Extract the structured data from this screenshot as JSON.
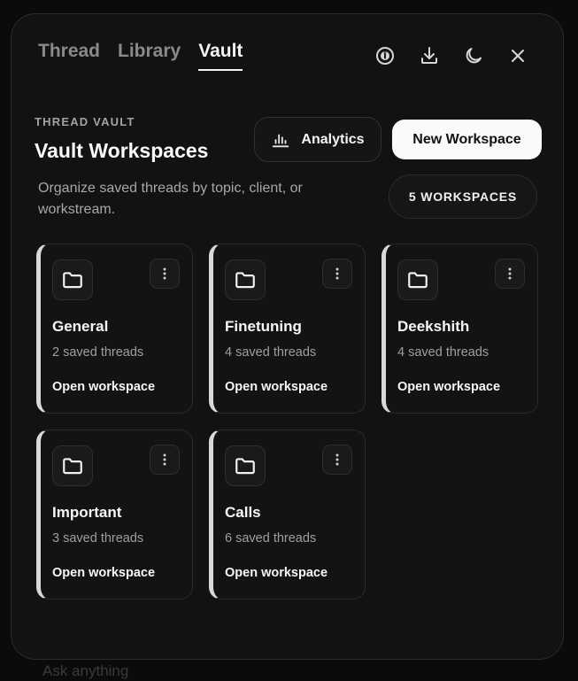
{
  "tabs": [
    {
      "label": "Thread",
      "active": false
    },
    {
      "label": "Library",
      "active": false
    },
    {
      "label": "Vault",
      "active": true
    }
  ],
  "toolbar": {
    "icons": [
      "info-icon",
      "download-icon",
      "moon-icon",
      "close-icon"
    ]
  },
  "header": {
    "eyebrow": "THREAD VAULT",
    "title": "Vault Workspaces",
    "description": "Organize saved threads by topic, client, or workstream.",
    "analytics_label": "Analytics",
    "new_workspace_label": "New Workspace",
    "workspace_count_badge": "5 WORKSPACES"
  },
  "workspaces": [
    {
      "name": "General",
      "count": "2 saved threads",
      "action": "Open workspace"
    },
    {
      "name": "Finetuning",
      "count": "4 saved threads",
      "action": "Open workspace"
    },
    {
      "name": "Deekshith",
      "count": "4 saved threads",
      "action": "Open workspace"
    },
    {
      "name": "Important",
      "count": "3 saved threads",
      "action": "Open workspace"
    },
    {
      "name": "Calls",
      "count": "6 saved threads",
      "action": "Open workspace"
    }
  ],
  "background": {
    "composer_placeholder": "Ask anything"
  },
  "colors": {
    "panel_bg": "#121212",
    "accent_white": "#fafafa",
    "card_stripe": "#d9d9d9"
  }
}
